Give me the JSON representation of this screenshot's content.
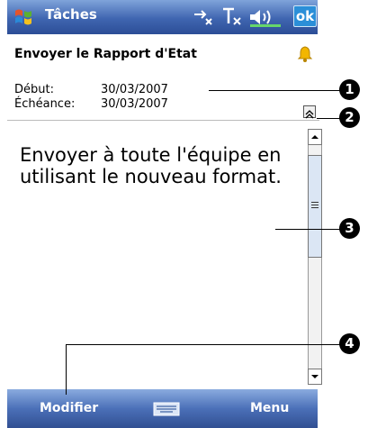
{
  "titlebar": {
    "app_title": "Tâches",
    "ok_label": "ok"
  },
  "task": {
    "title": "Envoyer le Rapport d'Etat"
  },
  "fields": {
    "start_label": "Début:",
    "start_value": "30/03/2007",
    "due_label": "Échéance:",
    "due_value": "30/03/2007"
  },
  "notes": {
    "text": "Envoyer à toute l'équipe en utilisant le nouveau format."
  },
  "menubar": {
    "left_label": "Modifier",
    "right_label": "Menu"
  },
  "callouts": [
    "1",
    "2",
    "3",
    "4"
  ],
  "colors": {
    "titlebar": "#3f65b0",
    "menubar": "#4b70b8",
    "ok_button": "#2b8fd8",
    "bell": "#f2b600"
  },
  "icons": [
    "windows-start-icon",
    "sync-icon",
    "signal-off-icon",
    "volume-icon",
    "bell-icon",
    "keyboard-icon",
    "collapse-chevron-icon"
  ]
}
